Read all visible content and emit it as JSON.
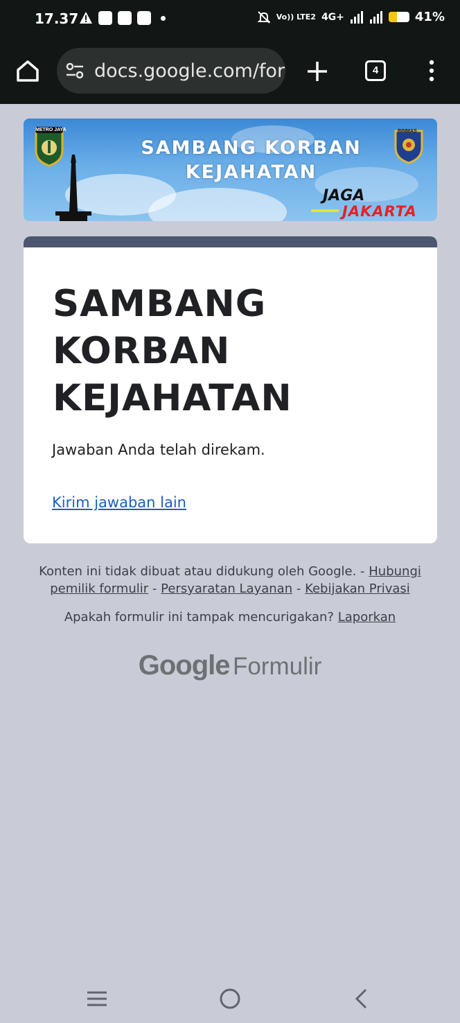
{
  "status_bar": {
    "time": "17.37",
    "network_mini": "Vo)) LTE2",
    "network_type": "4G+",
    "battery_percent": "41%",
    "battery_level": 0.41
  },
  "browser": {
    "url": "docs.google.com/forms",
    "tab_count": "4"
  },
  "banner": {
    "line1": "SAMBANG KORBAN",
    "line2": "KEJAHATAN",
    "badge_left": "METRO JAYA",
    "badge_right": "BINMAS",
    "slogan_top": "JAGA",
    "slogan_bottom": "JAKARTA"
  },
  "form": {
    "title": "SAMBANG KORBAN KEJAHATAN",
    "confirmation": "Jawaban Anda telah direkam.",
    "another_response_link": "Kirim jawaban lain"
  },
  "footer": {
    "disclaimer": "Konten ini tidak dibuat atau didukung oleh Google. -",
    "contact_owner": "Hubungi pemilik formulir",
    "sep1": "-",
    "terms": "Persyaratan Layanan",
    "sep2": "-",
    "privacy": "Kebijakan Privasi",
    "suspicious": "Apakah formulir ini tampak mencurigakan?",
    "report": "Laporkan",
    "brand_google": "Google",
    "brand_forms": "Formulir"
  },
  "colors": {
    "status_bg": "#121614",
    "page_bg": "#c9ccd7",
    "card_accent": "#4d5670",
    "link": "#1a5fc0"
  }
}
